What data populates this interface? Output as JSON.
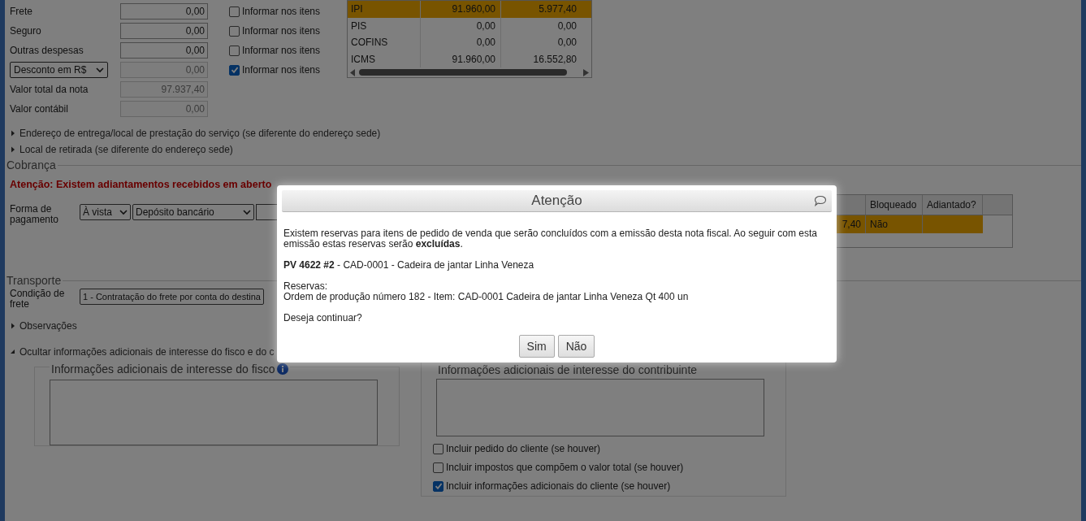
{
  "totals": [
    {
      "kind": "field",
      "label": "Frete",
      "value": "0,00",
      "disabled": false
    },
    {
      "kind": "field",
      "label": "Seguro",
      "value": "0,00",
      "disabled": false
    },
    {
      "kind": "field",
      "label": "Outras despesas",
      "value": "0,00",
      "disabled": false
    },
    {
      "kind": "select",
      "label": "Desconto em R$",
      "value": "0,00",
      "disabled": true
    },
    {
      "kind": "field",
      "label": "Valor total da nota",
      "value": "97.937,40",
      "disabled": true
    },
    {
      "kind": "field",
      "label": "Valor contábil",
      "value": "0,00",
      "disabled": true
    }
  ],
  "item_checks": [
    {
      "label": "Informar nos itens",
      "checked": false
    },
    {
      "label": "Informar nos itens",
      "checked": false
    },
    {
      "label": "Informar nos itens",
      "checked": false
    },
    {
      "label": "Informar nos itens",
      "checked": true
    }
  ],
  "tax_table": {
    "rows": [
      {
        "tax": "IPI",
        "base": "91.960,00",
        "value": "5.977,40",
        "selected": true
      },
      {
        "tax": "PIS",
        "base": "0,00",
        "value": "0,00",
        "selected": false
      },
      {
        "tax": "COFINS",
        "base": "0,00",
        "value": "0,00",
        "selected": false
      },
      {
        "tax": "ICMS",
        "base": "91.960,00",
        "value": "16.552,80",
        "selected": false
      }
    ]
  },
  "sections": [
    {
      "label": "Endereço de entrega/local de prestação do serviço (se diferente do endereço sede)",
      "expanded": false
    },
    {
      "label": "Local de retirada (se diferente do endereço sede)",
      "expanded": false
    }
  ],
  "cobranca": {
    "title": "Cobrança",
    "warning": "Atenção: Existem adiantamentos recebidos em aberto",
    "payment_label": "Forma de pagamento",
    "selects": [
      "À vista",
      "Depósito bancário"
    ],
    "table": {
      "columns": [
        "",
        "Bloqueado",
        "Adiantado?"
      ],
      "rows": [
        {
          "cells": [
            "7,40",
            "Não"
          ],
          "selected": true
        }
      ]
    }
  },
  "transporte": {
    "title": "Transporte",
    "label": "Condição de frete",
    "value": "1 - Contratação do frete por conta do destina"
  },
  "more_sections": [
    {
      "label": "Observações",
      "expanded": false
    },
    {
      "label": "Ocultar informações adicionais de interesse do fisco e do c",
      "expanded": true
    }
  ],
  "info_fisco": {
    "title": "Informações adicionais de interesse do fisco"
  },
  "info_contribuinte": {
    "title": "Informações adicionais de interesse do contribuinte",
    "options": [
      {
        "label": "Incluir pedido do cliente (se houver)",
        "checked": false
      },
      {
        "label": "Incluir impostos que compõem o valor total (se houver)",
        "checked": false
      },
      {
        "label": "Incluir informações adicionais do cliente (se houver)",
        "checked": true
      }
    ]
  },
  "dialog": {
    "title": "Atenção",
    "message": "Existem reservas para itens de pedido de venda que serão concluídos com a emissão desta nota fiscal. Ao seguir com esta emissão estas reservas serão **excluídas**.",
    "item": "**PV 4622 #2** - CAD-0001 - Cadeira de jantar Linha Veneza",
    "reservas_label": "Reservas:",
    "reserva": "Ordem de produção número 182 - Item: CAD-0001 Cadeira de jantar Linha Veneza Qt 400 un",
    "question": "Deseja continuar?",
    "buttons": [
      "Sim",
      "Não"
    ]
  }
}
